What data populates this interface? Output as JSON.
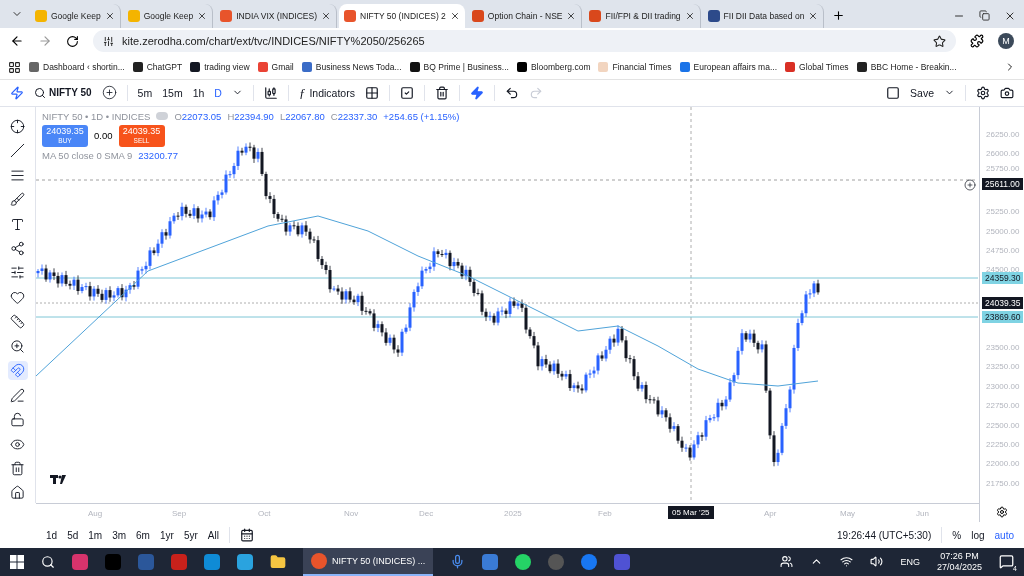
{
  "browser": {
    "tabs": [
      {
        "title": "Google Keep",
        "selected": false,
        "color": "#f4b400"
      },
      {
        "title": "Google Keep",
        "selected": false,
        "color": "#f4b400"
      },
      {
        "title": "INDIA VIX (INDICES)",
        "selected": false,
        "color": "#e8542b"
      },
      {
        "title": "NIFTY 50 (INDICES) 2",
        "selected": true,
        "color": "#e8542b"
      },
      {
        "title": "Option Chain - NSE",
        "selected": false,
        "color": "#d9481c"
      },
      {
        "title": "FII/FPI & DII trading",
        "selected": false,
        "color": "#d9481c"
      },
      {
        "title": "FII DII Data based on",
        "selected": false,
        "color": "#2d4a8a"
      }
    ],
    "url": "kite.zerodha.com/chart/ext/tvc/INDICES/NIFTY%2050/256265",
    "profile": "M",
    "bookmarks": [
      {
        "label": "Dashboard ‹ shortin...",
        "color": "#666666"
      },
      {
        "label": "ChatGPT",
        "color": "#222222"
      },
      {
        "label": "trading view",
        "color": "#131722"
      },
      {
        "label": "Gmail",
        "color": "#ea4335"
      },
      {
        "label": "Business News Toda...",
        "color": "#3b6cc7"
      },
      {
        "label": "BQ Prime | Business...",
        "color": "#111111"
      },
      {
        "label": "Bloomberg.com",
        "color": "#000000"
      },
      {
        "label": "Financial Times",
        "color": "#f2d5c0"
      },
      {
        "label": "European affairs ma...",
        "color": "#1a73e8"
      },
      {
        "label": "Global Times",
        "color": "#d93025"
      },
      {
        "label": "BBC Home - Breakin...",
        "color": "#222222"
      }
    ]
  },
  "toolbar": {
    "symbol": "NIFTY 50",
    "intervals": [
      {
        "label": "5m",
        "selected": false
      },
      {
        "label": "15m",
        "selected": false
      },
      {
        "label": "1h",
        "selected": false
      },
      {
        "label": "D",
        "selected": true
      }
    ],
    "indicators_icon": "ƒ",
    "indicators": "Indicators",
    "save": "Save",
    "redo_disabled": true
  },
  "tools": [
    {
      "kind": "cross",
      "selected": false
    },
    {
      "kind": "line",
      "selected": false
    },
    {
      "kind": "channel",
      "selected": false
    },
    {
      "kind": "brush",
      "selected": false
    },
    {
      "kind": "text",
      "selected": false
    },
    {
      "kind": "pattern",
      "selected": false
    },
    {
      "kind": "fib",
      "selected": false
    },
    {
      "kind": "heart",
      "selected": false
    },
    {
      "kind": "ruler",
      "selected": false
    },
    {
      "kind": "zoom",
      "selected": false
    },
    {
      "kind": "magnet",
      "selected": true
    },
    {
      "kind": "lockdraw",
      "selected": false
    },
    {
      "kind": "lock",
      "selected": false
    },
    {
      "kind": "eye",
      "selected": false
    },
    {
      "kind": "trash",
      "selected": false
    },
    {
      "kind": "home",
      "selected": false
    }
  ],
  "legend": {
    "title": "NIFTY 50 • 1D • INDICES",
    "ohlc": [
      {
        "label": "O",
        "value": "22073.05"
      },
      {
        "label": "H",
        "value": "22394.90"
      },
      {
        "label": "L",
        "value": "22067.80"
      },
      {
        "label": "C",
        "value": "22337.30"
      }
    ],
    "change": "+254.65 (+1.15%)",
    "buy": {
      "price": "24039.35",
      "label": "BUY"
    },
    "spread": "0.00",
    "sell": {
      "price": "24039.35",
      "label": "SELL"
    },
    "ma": {
      "label": "MA 50 close 0 SMA 9",
      "value": "23200.77"
    }
  },
  "y_axis": [
    "26250.00",
    "26000.00",
    "25750.00",
    "25250.00",
    "25000.00",
    "24750.00",
    "24500.00",
    "23500.00",
    "23250.00",
    "23000.00",
    "22750.00",
    "22500.00",
    "22250.00",
    "22000.00",
    "21750.00"
  ],
  "price_badges": [
    {
      "kind": "alert",
      "value": "25611.00"
    },
    {
      "kind": "line",
      "value": "24359.30"
    },
    {
      "kind": "last",
      "value": "24039.35"
    },
    {
      "kind": "line",
      "value": "23869.60"
    }
  ],
  "x_axis": [
    "Aug",
    "Sep",
    "Oct",
    "Nov",
    "Dec",
    "2025",
    "Feb",
    "Apr",
    "May",
    "Jun"
  ],
  "crosshair_date": "05 Mar '25",
  "ranges": [
    "1d",
    "5d",
    "1m",
    "3m",
    "6m",
    "1yr",
    "5yr",
    "All"
  ],
  "clock": "19:26:44 (UTC+5:30)",
  "scale_options": [
    {
      "label": "%",
      "selected": false
    },
    {
      "label": "log",
      "selected": false
    },
    {
      "label": "auto",
      "selected": true
    }
  ],
  "taskbar": {
    "active_window": "NIFTY 50 (INDICES) ...",
    "language": "ENG",
    "time": "07:26 PM",
    "date": "27/04/2025",
    "notifications": "4"
  }
}
